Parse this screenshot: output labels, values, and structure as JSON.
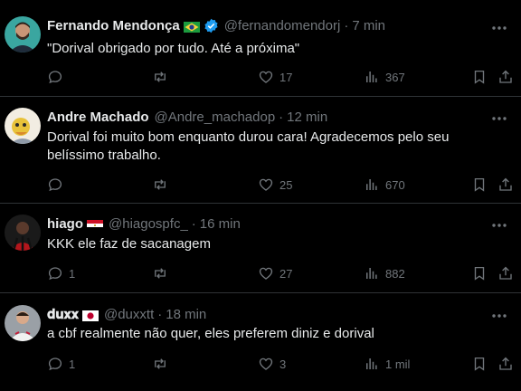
{
  "tweets": [
    {
      "name": "Fernando Mendonça",
      "flag": "brazil-flag-icon",
      "verified": true,
      "handle": "@fernandomendorj",
      "dot": "·",
      "time": "7 min",
      "text": "\"Dorival obrigado por tudo. Até a próxima\"",
      "replies": "",
      "retweets": "",
      "likes": "17",
      "views": "367"
    },
    {
      "name": "Andre Machado",
      "handle": "@Andre_machadop",
      "dot": "·",
      "time": "12 min",
      "text": "Dorival foi muito bom enquanto durou cara! Agradecemos pelo seu belíssimo trabalho.",
      "replies": "",
      "retweets": "",
      "likes": "25",
      "views": "670"
    },
    {
      "name": "hiago",
      "flag": "egypt-flag-icon",
      "handle": "@hiagospfc_",
      "dot": "·",
      "time": "16 min",
      "text": "KKK ele faz de sacanagem",
      "replies": "1",
      "retweets": "",
      "likes": "27",
      "views": "882"
    },
    {
      "name": "𝐝𝐮𝐱𝐱",
      "flag": "japan-flag-icon",
      "handle": "@duxxtt",
      "dot": "·",
      "time": "18 min",
      "text": "a cbf realmente não quer, eles preferem diniz e dorival",
      "replies": "1",
      "retweets": "",
      "likes": "3",
      "views": "1 mil"
    }
  ],
  "colors": {
    "background": "#000000",
    "text": "#e7e9ea",
    "muted": "#71767b",
    "border": "#2f3336",
    "verified": "#1d9bf0"
  }
}
